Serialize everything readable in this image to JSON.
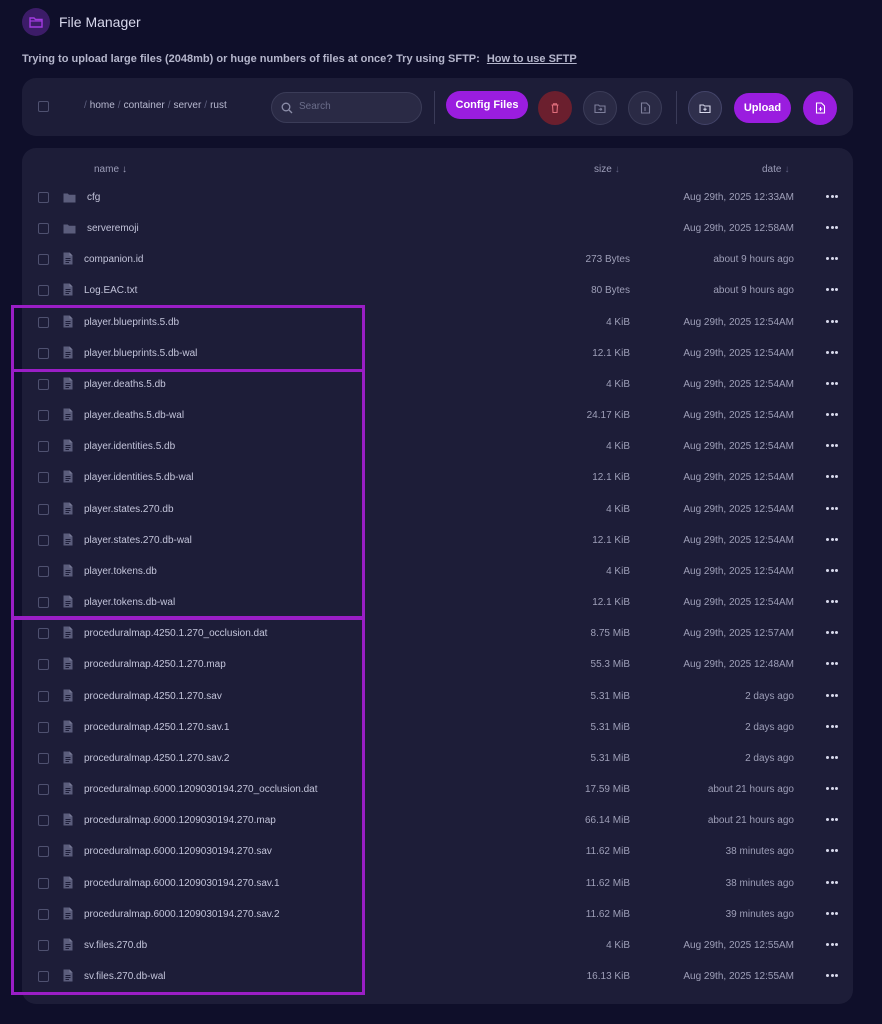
{
  "app": {
    "title": "File Manager",
    "icon": "folder-open-icon"
  },
  "notice": {
    "text": "Trying to upload large files (2048mb) or huge numbers of files at once? Try using SFTP:",
    "link": "How to use SFTP"
  },
  "toolbar": {
    "breadcrumbs": [
      "home",
      "container",
      "server",
      "rust"
    ],
    "search_placeholder": "Search",
    "config_files_label": "Config Files",
    "upload_label": "Upload"
  },
  "table": {
    "columns": {
      "name": "name",
      "size": "size",
      "date": "date"
    },
    "rows": [
      {
        "type": "folder",
        "name": "cfg",
        "size": "",
        "date": "Aug 29th, 2025 12:33AM"
      },
      {
        "type": "folder",
        "name": "serveremoji",
        "size": "",
        "date": "Aug 29th, 2025 12:58AM"
      },
      {
        "type": "file",
        "name": "companion.id",
        "size": "273 Bytes",
        "date": "about 9 hours ago"
      },
      {
        "type": "file",
        "name": "Log.EAC.txt",
        "size": "80 Bytes",
        "date": "about 9 hours ago"
      },
      {
        "type": "file",
        "name": "player.blueprints.5.db",
        "size": "4 KiB",
        "date": "Aug 29th, 2025 12:54AM"
      },
      {
        "type": "file",
        "name": "player.blueprints.5.db-wal",
        "size": "12.1 KiB",
        "date": "Aug 29th, 2025 12:54AM"
      },
      {
        "type": "file",
        "name": "player.deaths.5.db",
        "size": "4 KiB",
        "date": "Aug 29th, 2025 12:54AM"
      },
      {
        "type": "file",
        "name": "player.deaths.5.db-wal",
        "size": "24.17 KiB",
        "date": "Aug 29th, 2025 12:54AM"
      },
      {
        "type": "file",
        "name": "player.identities.5.db",
        "size": "4 KiB",
        "date": "Aug 29th, 2025 12:54AM"
      },
      {
        "type": "file",
        "name": "player.identities.5.db-wal",
        "size": "12.1 KiB",
        "date": "Aug 29th, 2025 12:54AM"
      },
      {
        "type": "file",
        "name": "player.states.270.db",
        "size": "4 KiB",
        "date": "Aug 29th, 2025 12:54AM"
      },
      {
        "type": "file",
        "name": "player.states.270.db-wal",
        "size": "12.1 KiB",
        "date": "Aug 29th, 2025 12:54AM"
      },
      {
        "type": "file",
        "name": "player.tokens.db",
        "size": "4 KiB",
        "date": "Aug 29th, 2025 12:54AM"
      },
      {
        "type": "file",
        "name": "player.tokens.db-wal",
        "size": "12.1 KiB",
        "date": "Aug 29th, 2025 12:54AM"
      },
      {
        "type": "file",
        "name": "proceduralmap.4250.1.270_occlusion.dat",
        "size": "8.75 MiB",
        "date": "Aug 29th, 2025 12:57AM"
      },
      {
        "type": "file",
        "name": "proceduralmap.4250.1.270.map",
        "size": "55.3 MiB",
        "date": "Aug 29th, 2025 12:48AM"
      },
      {
        "type": "file",
        "name": "proceduralmap.4250.1.270.sav",
        "size": "5.31 MiB",
        "date": "2 days ago"
      },
      {
        "type": "file",
        "name": "proceduralmap.4250.1.270.sav.1",
        "size": "5.31 MiB",
        "date": "2 days ago"
      },
      {
        "type": "file",
        "name": "proceduralmap.4250.1.270.sav.2",
        "size": "5.31 MiB",
        "date": "2 days ago"
      },
      {
        "type": "file",
        "name": "proceduralmap.6000.1209030194.270_occlusion.dat",
        "size": "17.59 MiB",
        "date": "about 21 hours ago"
      },
      {
        "type": "file",
        "name": "proceduralmap.6000.1209030194.270.map",
        "size": "66.14 MiB",
        "date": "about 21 hours ago"
      },
      {
        "type": "file",
        "name": "proceduralmap.6000.1209030194.270.sav",
        "size": "11.62 MiB",
        "date": "38 minutes ago"
      },
      {
        "type": "file",
        "name": "proceduralmap.6000.1209030194.270.sav.1",
        "size": "11.62 MiB",
        "date": "38 minutes ago"
      },
      {
        "type": "file",
        "name": "proceduralmap.6000.1209030194.270.sav.2",
        "size": "11.62 MiB",
        "date": "39 minutes ago"
      },
      {
        "type": "file",
        "name": "sv.files.270.db",
        "size": "4 KiB",
        "date": "Aug 29th, 2025 12:55AM"
      },
      {
        "type": "file",
        "name": "sv.files.270.db-wal",
        "size": "16.13 KiB",
        "date": "Aug 29th, 2025 12:55AM"
      }
    ]
  },
  "colors": {
    "accent": "#9a1ddf",
    "highlight": "#9a1ec6",
    "danger": "#6b1f2e",
    "background": "#0f0f2a",
    "panel": "#1d1d38"
  }
}
